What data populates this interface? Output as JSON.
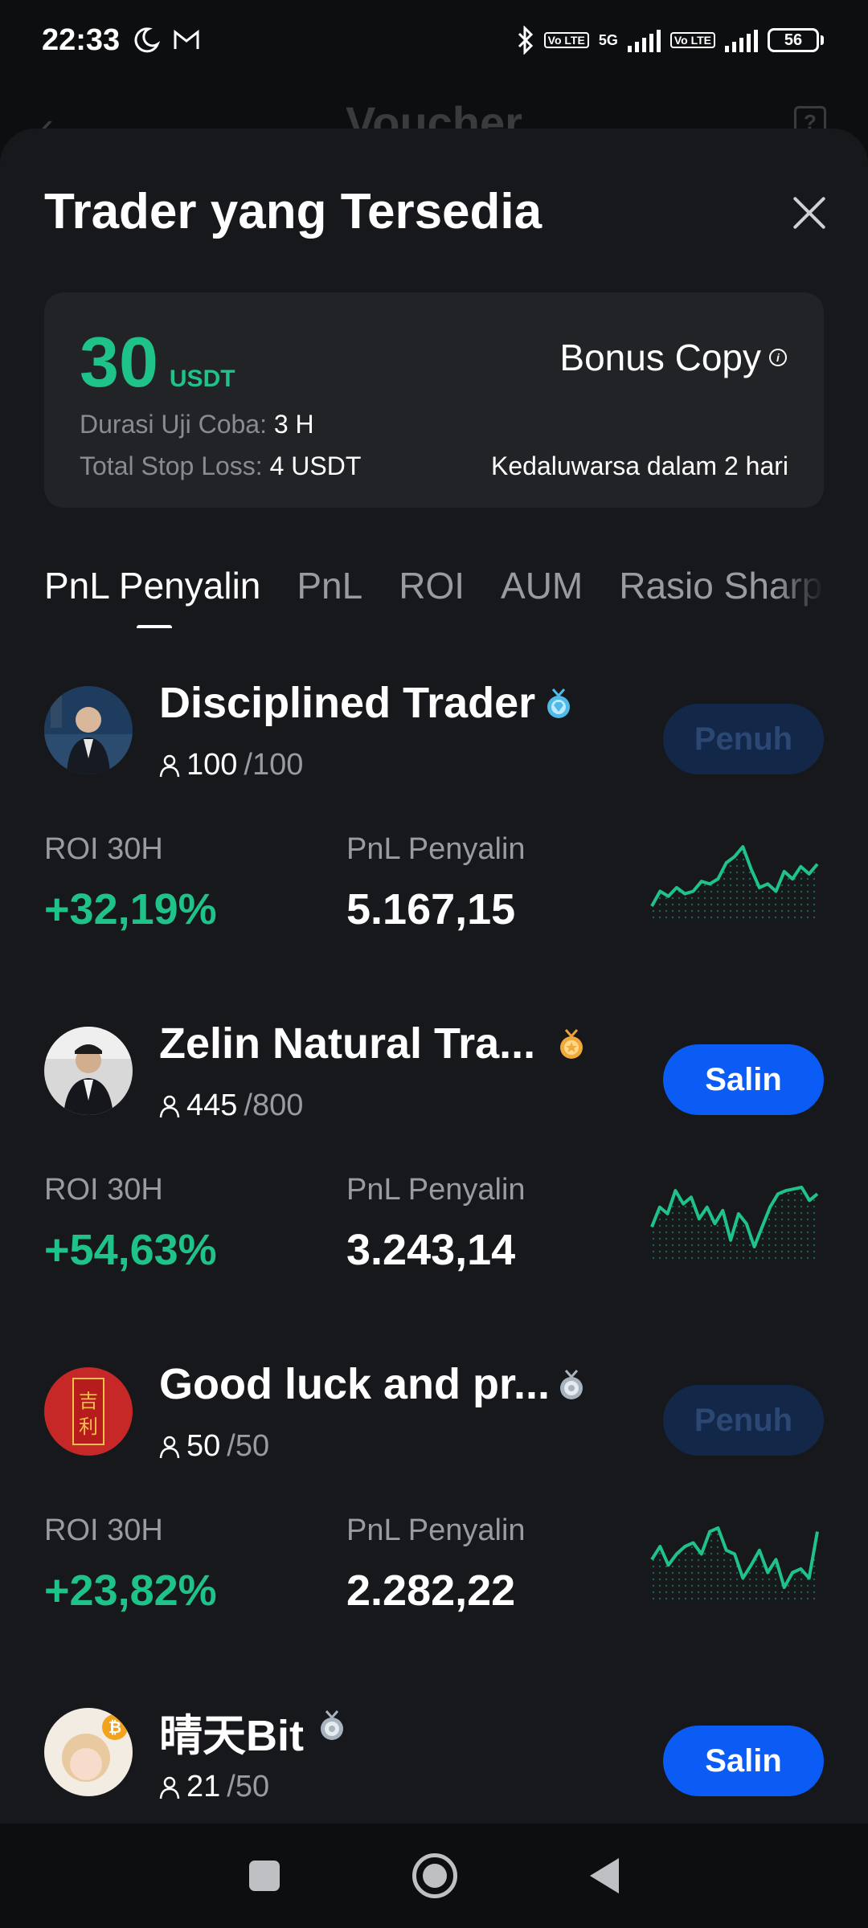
{
  "status_bar": {
    "time": "22:33",
    "network": "5G",
    "lte_label": "Vo LTE",
    "battery": "56"
  },
  "background_page": {
    "title": "Voucher"
  },
  "sheet": {
    "title": "Trader yang Tersedia",
    "bonus": {
      "amount": "30",
      "currency": "USDT",
      "label": "Bonus Copy",
      "trial_duration_label": "Durasi Uji Coba:",
      "trial_duration_value": "3 H",
      "stop_loss_label": "Total Stop Loss:",
      "stop_loss_value": "4 USDT",
      "expiry": "Kedaluwarsa dalam 2 hari"
    },
    "tabs": [
      {
        "label": "PnL Penyalin",
        "active": true
      },
      {
        "label": "PnL",
        "active": false
      },
      {
        "label": "ROI",
        "active": false
      },
      {
        "label": "AUM",
        "active": false
      },
      {
        "label": "Rasio Sharpe",
        "active": false
      }
    ],
    "stat_labels": {
      "roi": "ROI 30H",
      "pnl": "PnL Penyalin"
    },
    "traders": [
      {
        "name": "Disciplined Trader",
        "badge": "diamond-medal-icon",
        "followers": "100",
        "followers_max": "/100",
        "button": "Penuh",
        "button_state": "full",
        "roi": "+32,19%",
        "pnl": "5.167,15",
        "sparkline": [
          40,
          52,
          48,
          55,
          50,
          52,
          60,
          58,
          62,
          75,
          80,
          88,
          70,
          55,
          58,
          52,
          68,
          62,
          72,
          66,
          74
        ]
      },
      {
        "name": "Zelin Natural Tra...",
        "badge": "gold-medal-icon",
        "followers": "445",
        "followers_max": "/800",
        "button": "Salin",
        "button_state": "enabled",
        "roi": "+54,63%",
        "pnl": "3.243,14",
        "sparkline": [
          50,
          62,
          58,
          72,
          64,
          68,
          55,
          62,
          52,
          60,
          42,
          58,
          52,
          38,
          50,
          62,
          70,
          72,
          73,
          74,
          66,
          70
        ]
      },
      {
        "name": "Good luck and pr...",
        "badge": "silver-medal-icon",
        "followers": "50",
        "followers_max": "/50",
        "button": "Penuh",
        "button_state": "full",
        "roi": "+23,82%",
        "pnl": "2.282,22",
        "sparkline": [
          55,
          62,
          52,
          58,
          62,
          64,
          58,
          70,
          72,
          60,
          58,
          45,
          52,
          60,
          48,
          55,
          40,
          48,
          50,
          45,
          70
        ]
      },
      {
        "name": "晴天Bit",
        "badge": "silver-medal-icon",
        "followers": "21",
        "followers_max": "/50",
        "button": "Salin",
        "button_state": "enabled"
      }
    ]
  },
  "colors": {
    "accent_green": "#1fc38a",
    "button_blue": "#0a5cf5",
    "sheet_bg": "#17181b"
  }
}
